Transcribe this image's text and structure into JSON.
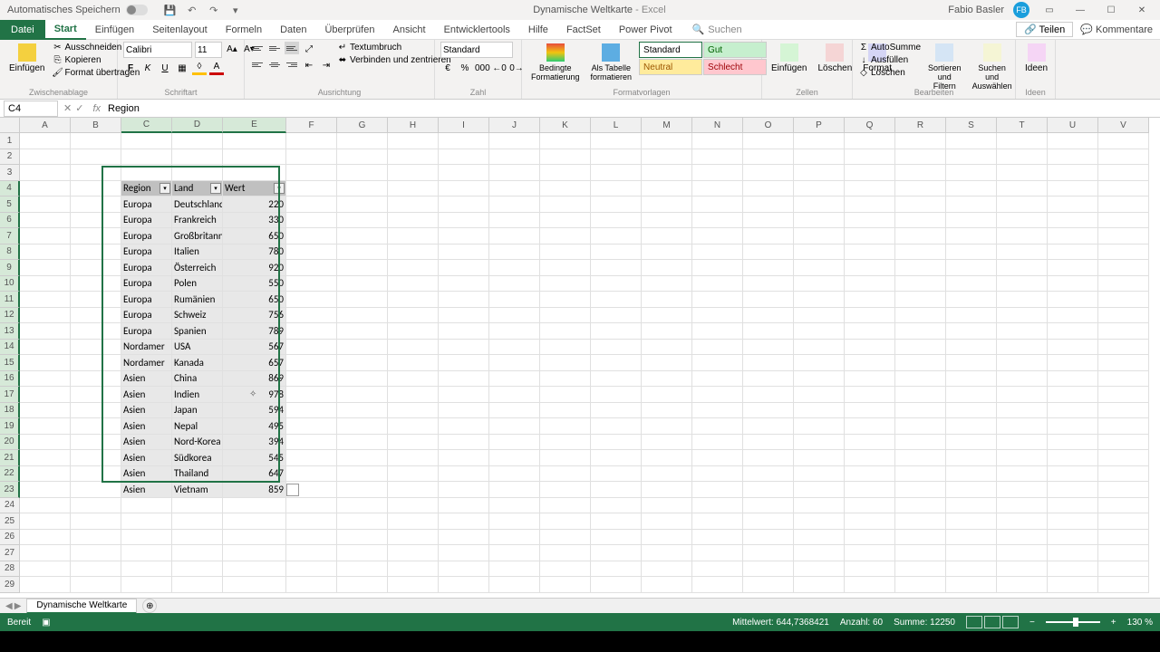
{
  "titlebar": {
    "autosave": "Automatisches Speichern",
    "doc_title": "Dynamische Weltkarte",
    "app_name": "Excel",
    "user": "Fabio Basler",
    "user_initials": "FB"
  },
  "tabs": {
    "file": "Datei",
    "items": [
      "Start",
      "Einfügen",
      "Seitenlayout",
      "Formeln",
      "Daten",
      "Überprüfen",
      "Ansicht",
      "Entwicklertools",
      "Hilfe",
      "FactSet",
      "Power Pivot"
    ],
    "search": "Suchen",
    "share": "Teilen",
    "comments": "Kommentare"
  },
  "ribbon": {
    "clipboard": {
      "label": "Zwischenablage",
      "paste": "Einfügen",
      "cut": "Ausschneiden",
      "copy": "Kopieren",
      "format_painter": "Format übertragen"
    },
    "font": {
      "label": "Schriftart",
      "name": "Calibri",
      "size": "11"
    },
    "alignment": {
      "label": "Ausrichtung",
      "wrap": "Textumbruch",
      "merge": "Verbinden und zentrieren"
    },
    "number": {
      "label": "Zahl",
      "format": "Standard"
    },
    "styles": {
      "label": "Formatvorlagen",
      "conditional": "Bedingte Formatierung",
      "as_table": "Als Tabelle formatieren",
      "standard": "Standard",
      "gut": "Gut",
      "neutral": "Neutral",
      "schlecht": "Schlecht"
    },
    "cells": {
      "label": "Zellen",
      "insert": "Einfügen",
      "delete": "Löschen",
      "format": "Format"
    },
    "editing": {
      "label": "Bearbeiten",
      "autosum": "AutoSumme",
      "fill": "Ausfüllen",
      "clear": "Löschen",
      "sort": "Sortieren und Filtern",
      "find": "Suchen und Auswählen"
    },
    "ideas": {
      "label": "Ideen",
      "btn": "Ideen"
    }
  },
  "formula_bar": {
    "name_box": "C4",
    "formula": "Region"
  },
  "columns": [
    "A",
    "B",
    "C",
    "D",
    "E",
    "F",
    "G",
    "H",
    "I",
    "J",
    "K",
    "L",
    "M",
    "N",
    "O",
    "P",
    "Q",
    "R",
    "S",
    "T",
    "U",
    "V"
  ],
  "headers": {
    "region": "Region",
    "land": "Land",
    "wert": "Wert"
  },
  "table_data": [
    {
      "region": "Europa",
      "land": "Deutschland",
      "wert": 220
    },
    {
      "region": "Europa",
      "land": "Frankreich",
      "wert": 330
    },
    {
      "region": "Europa",
      "land": "Großbritannien",
      "wert": 650
    },
    {
      "region": "Europa",
      "land": "Italien",
      "wert": 780
    },
    {
      "region": "Europa",
      "land": "Österreich",
      "wert": 920
    },
    {
      "region": "Europa",
      "land": "Polen",
      "wert": 550
    },
    {
      "region": "Europa",
      "land": "Rumänien",
      "wert": 650
    },
    {
      "region": "Europa",
      "land": "Schweiz",
      "wert": 756
    },
    {
      "region": "Europa",
      "land": "Spanien",
      "wert": 789
    },
    {
      "region": "Nordamerika",
      "land": "USA",
      "wert": 567
    },
    {
      "region": "Nordamerika",
      "land": "Kanada",
      "wert": 657
    },
    {
      "region": "Asien",
      "land": "China",
      "wert": 869
    },
    {
      "region": "Asien",
      "land": "Indien",
      "wert": 978
    },
    {
      "region": "Asien",
      "land": "Japan",
      "wert": 594
    },
    {
      "region": "Asien",
      "land": "Nepal",
      "wert": 495
    },
    {
      "region": "Asien",
      "land": "Nord-Korea",
      "wert": 394
    },
    {
      "region": "Asien",
      "land": "Südkorea",
      "wert": 545
    },
    {
      "region": "Asien",
      "land": "Thailand",
      "wert": 647
    },
    {
      "region": "Asien",
      "land": "Vietnam",
      "wert": 859
    }
  ],
  "sheet": {
    "name": "Dynamische Weltkarte",
    "status": "Bereit"
  },
  "status": {
    "avg_label": "Mittelwert:",
    "avg": "644,7368421",
    "count_label": "Anzahl:",
    "count": "60",
    "sum_label": "Summe:",
    "sum": "12250",
    "zoom": "130 %"
  }
}
